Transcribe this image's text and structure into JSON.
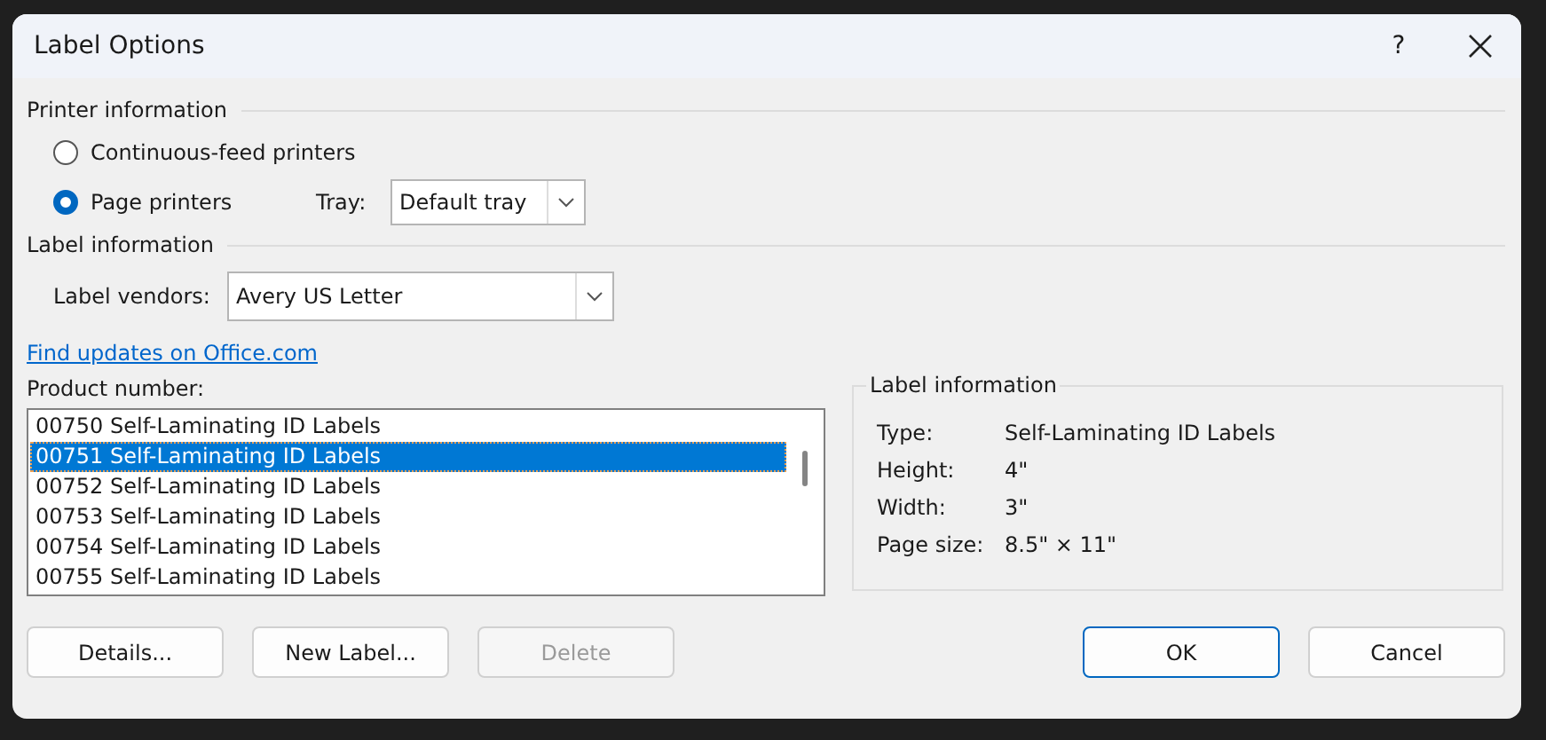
{
  "window": {
    "title": "Label Options",
    "help": "?"
  },
  "printer_information": {
    "heading": "Printer information",
    "options": [
      {
        "label": "Continuous-feed printers",
        "selected": false
      },
      {
        "label": "Page printers",
        "selected": true
      }
    ],
    "tray": {
      "label": "Tray:",
      "value": "Default tray"
    }
  },
  "label_information": {
    "heading": "Label information",
    "vendor": {
      "label": "Label vendors:",
      "value": "Avery US Letter"
    },
    "link": "Find updates on Office.com"
  },
  "product_number": {
    "label": "Product number:",
    "items": [
      {
        "label": "00750 Self-Laminating ID Labels",
        "selected": false
      },
      {
        "label": "00751 Self-Laminating ID Labels",
        "selected": true
      },
      {
        "label": "00752 Self-Laminating ID Labels",
        "selected": false
      },
      {
        "label": "00753 Self-Laminating ID Labels",
        "selected": false
      },
      {
        "label": "00754 Self-Laminating ID Labels",
        "selected": false
      },
      {
        "label": "00755 Self-Laminating ID Labels",
        "selected": false
      }
    ]
  },
  "details_panel": {
    "heading": "Label information",
    "rows": [
      {
        "label": "Type:",
        "value": "Self-Laminating ID Labels"
      },
      {
        "label": "Height:",
        "value": "4\""
      },
      {
        "label": "Width:",
        "value": "3\""
      },
      {
        "label": "Page size:",
        "value": "8.5\" × 11\""
      }
    ]
  },
  "buttons": [
    {
      "label": "Details...",
      "disabled": false,
      "default": false
    },
    {
      "label": "New Label...",
      "disabled": false,
      "default": false
    },
    {
      "label": "Delete",
      "disabled": true,
      "default": false
    },
    {
      "label": "OK",
      "disabled": false,
      "default": true
    },
    {
      "label": "Cancel",
      "disabled": false,
      "default": false
    }
  ]
}
